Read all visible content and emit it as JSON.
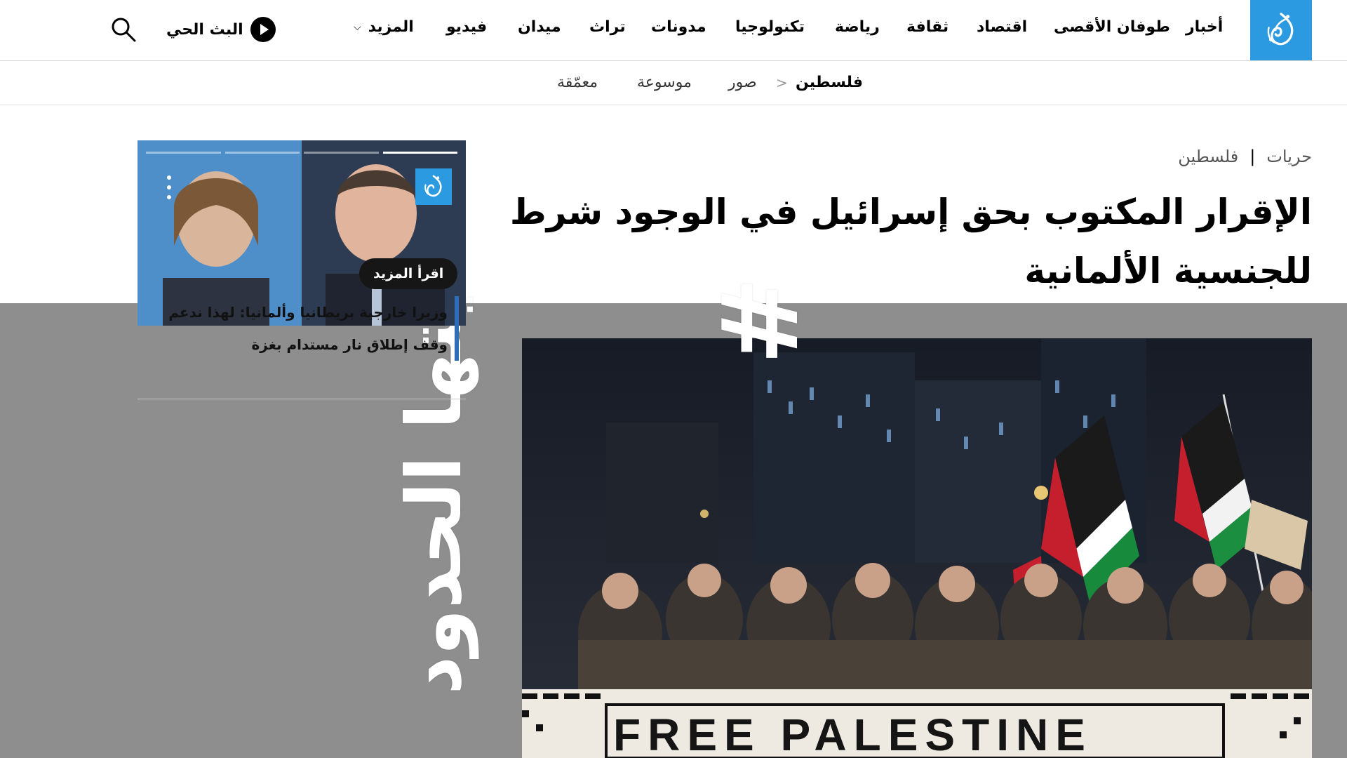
{
  "nav": {
    "logo_name": "aljazeera-logo",
    "items": [
      "أخبار",
      "طوفان الأقصى",
      "اقتصاد",
      "ثقافة",
      "رياضة",
      "تكنولوجيا",
      "مدونات",
      "تراث",
      "ميدان",
      "فيديو"
    ],
    "more_label": "المزيد",
    "live_label": "البث الحي",
    "brand_color": "#2c9ae0"
  },
  "subnav": {
    "current": "فلسطين",
    "items": [
      "صور",
      "موسوعة",
      "معمّقة"
    ]
  },
  "article": {
    "breadcrumb": [
      "حريات",
      "فلسطين"
    ],
    "headline_line1": "الإقرار المكتوب بحق إسرائيل في الوجود شرط",
    "headline_line2": "للجنسية الألمانية"
  },
  "hero": {
    "banner_text": "FREE PALESTINE",
    "campaign_hashtag": "#",
    "campaign_text": "ليتها الحدود"
  },
  "video_widget": {
    "read_more_label": "اقرأ المزيد",
    "caption": "وزيرا خارجية بريطانيا وألمانيا: لهذا ندعم وقف إطلاق نار مستدام بغزة",
    "progress_segments": 4,
    "active_segment": 4,
    "accent_color": "#2c6fb8"
  }
}
